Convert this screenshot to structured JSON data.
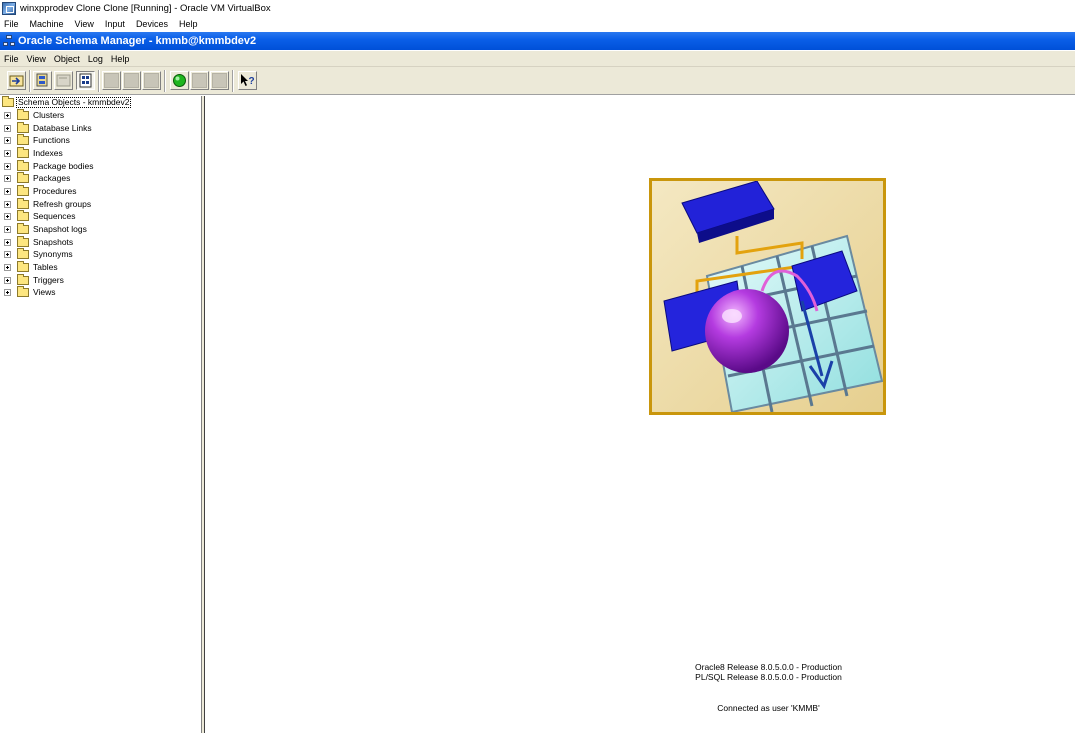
{
  "vbox": {
    "title": "winxpprodev Clone Clone [Running] - Oracle VM VirtualBox",
    "menu": [
      "File",
      "Machine",
      "View",
      "Input",
      "Devices",
      "Help"
    ]
  },
  "app": {
    "title": "Oracle Schema Manager - kmmb@kmmbdev2",
    "menu": [
      "File",
      "View",
      "Object",
      "Log",
      "Help"
    ]
  },
  "toolbar": {
    "buttons": [
      {
        "icon": "connect-icon",
        "enabled": true
      },
      {
        "icon": "database-icon",
        "enabled": true
      },
      {
        "icon": "properties-icon",
        "enabled": false
      },
      {
        "icon": "show-objects-icon",
        "enabled": true,
        "pressed": true
      },
      {
        "icon": "blank-icon",
        "enabled": false
      },
      {
        "icon": "blank-icon",
        "enabled": false
      },
      {
        "icon": "blank-icon",
        "enabled": false
      },
      {
        "icon": "green-light-icon",
        "enabled": true
      },
      {
        "icon": "blank-icon",
        "enabled": false
      },
      {
        "icon": "blank-icon",
        "enabled": false
      },
      {
        "icon": "context-help-icon",
        "enabled": true
      }
    ]
  },
  "tree": {
    "root": "Schema Objects - kmmbdev2",
    "items": [
      "Clusters",
      "Database Links",
      "Functions",
      "Indexes",
      "Package bodies",
      "Packages",
      "Procedures",
      "Refresh groups",
      "Sequences",
      "Snapshot logs",
      "Snapshots",
      "Synonyms",
      "Tables",
      "Triggers",
      "Views"
    ]
  },
  "info": {
    "line1": "Oracle8 Release 8.0.5.0.0 - Production",
    "line2": "PL/SQL Release 8.0.5.0.0 - Production",
    "connected": "Connected as user 'KMMB'"
  }
}
